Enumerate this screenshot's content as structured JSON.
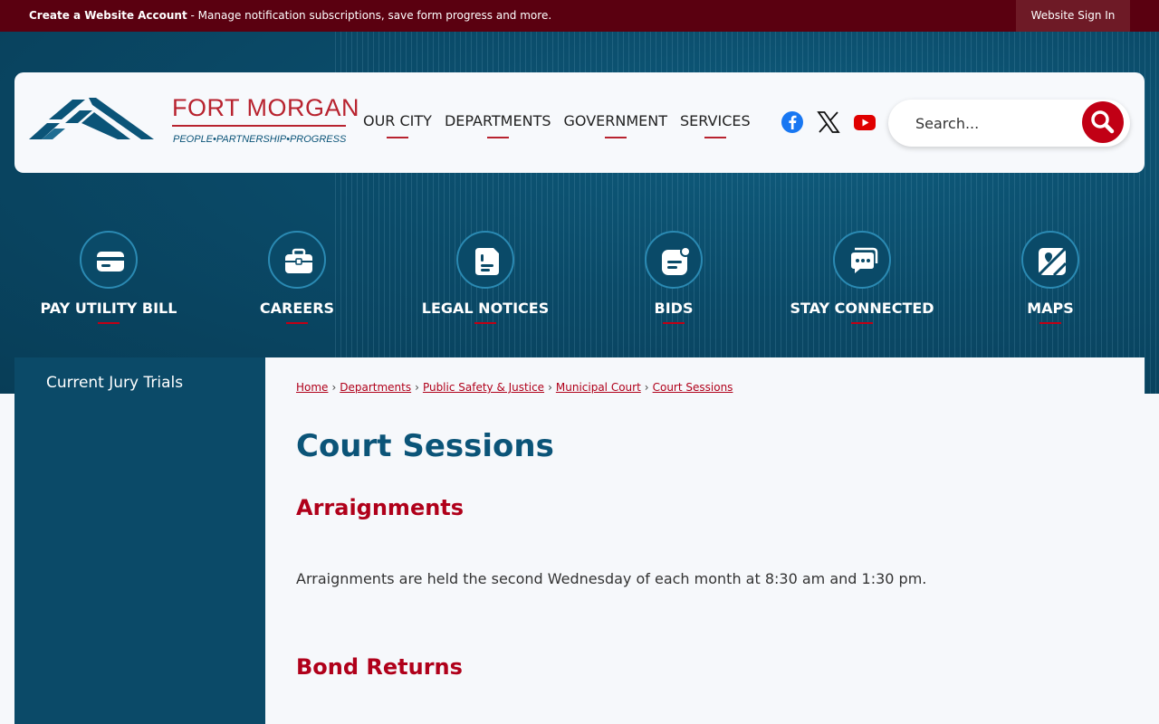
{
  "topbar": {
    "create_account": "Create a Website Account",
    "message": " - Manage notification subscriptions, save form progress and more.",
    "signin": "Website Sign In"
  },
  "header": {
    "logo_title": "FORT MORGAN",
    "logo_tagline": "PEOPLE•PARTNERSHIP•PROGRESS",
    "nav": [
      {
        "label": "OUR CITY"
      },
      {
        "label": "DEPARTMENTS"
      },
      {
        "label": "GOVERNMENT"
      },
      {
        "label": "SERVICES"
      }
    ],
    "social": [
      "facebook-icon",
      "x-icon",
      "youtube-icon"
    ],
    "search_placeholder": "Search..."
  },
  "quick_links": [
    {
      "label": "PAY UTILITY BILL",
      "icon": "credit-card-icon"
    },
    {
      "label": "CAREERS",
      "icon": "briefcase-icon"
    },
    {
      "label": "LEGAL NOTICES",
      "icon": "document-icon"
    },
    {
      "label": "BIDS",
      "icon": "notification-icon"
    },
    {
      "label": "STAY CONNECTED",
      "icon": "chat-icon"
    },
    {
      "label": "MAPS",
      "icon": "map-icon"
    }
  ],
  "sidebar": {
    "items": [
      {
        "label": "Current Jury Trials"
      }
    ]
  },
  "breadcrumb": [
    {
      "label": "Home"
    },
    {
      "label": "Departments"
    },
    {
      "label": "Public Safety & Justice"
    },
    {
      "label": "Municipal Court"
    },
    {
      "label": "Court Sessions"
    }
  ],
  "main": {
    "title": "Court Sessions",
    "sections": [
      {
        "heading": "Arraignments",
        "body": "Arraignments are held the second Wednesday of each month at 8:30 am and 1:30 pm."
      },
      {
        "heading": "Bond Returns"
      }
    ]
  },
  "colors": {
    "brand_red": "#b8232f",
    "brand_blue": "#0b5478",
    "topbar": "#5a0010"
  }
}
